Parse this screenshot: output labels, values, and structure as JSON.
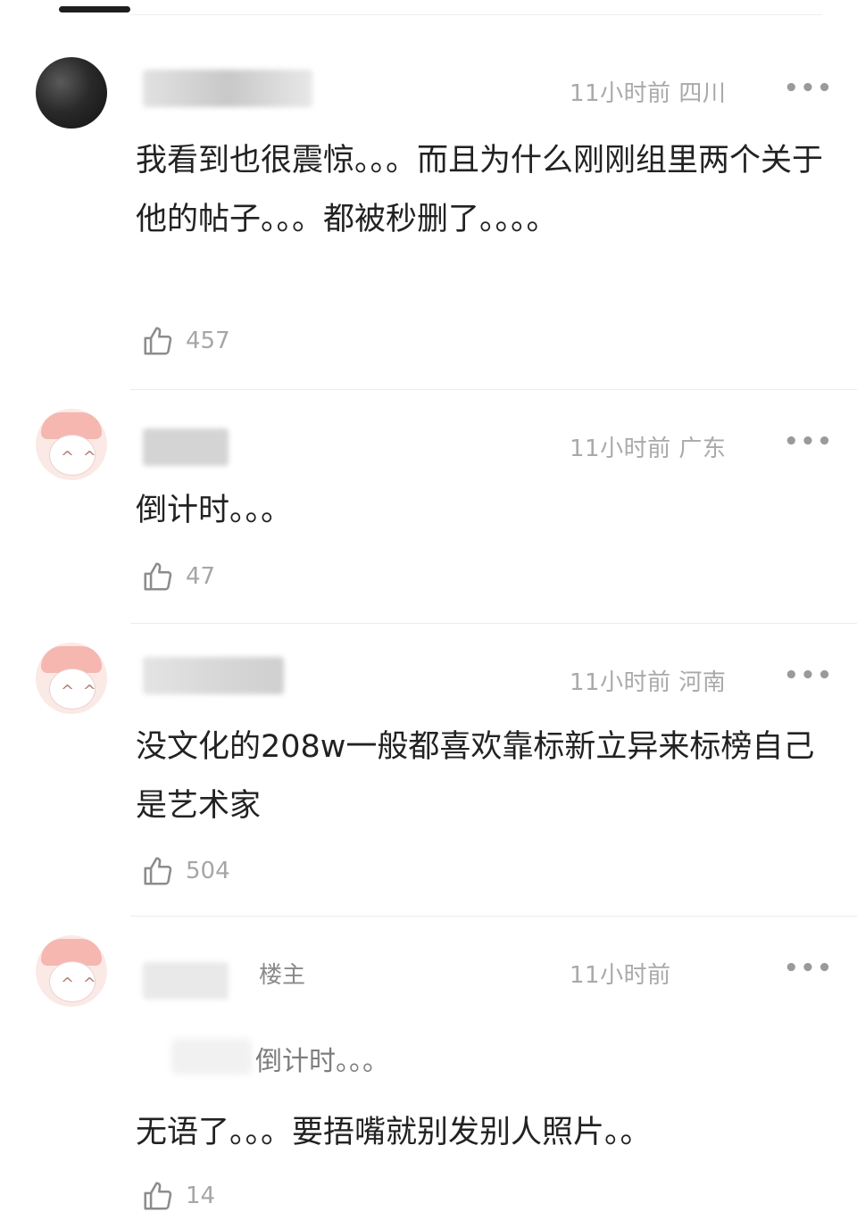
{
  "comments": [
    {
      "time": "11小时前",
      "location": "四川",
      "more": "•••",
      "text": "我看到也很震惊。。。而且为什么刚刚组里两个关于他的帖子。。。都被秒删了。。。。",
      "likes": "457"
    },
    {
      "time": "11小时前",
      "location": "广东",
      "more": "•••",
      "text": "倒计时。。。",
      "likes": "47"
    },
    {
      "time": "11小时前",
      "location": "河南",
      "more": "•••",
      "text": "没文化的208w一般都喜欢靠标新立异来标榜自己是艺术家",
      "likes": "504"
    },
    {
      "badge": "楼主",
      "time": "11小时前",
      "more": "•••",
      "quote": "倒计时。。。",
      "text": "无语了。。。要捂嘴就别发别人照片。。",
      "likes": "14"
    }
  ]
}
